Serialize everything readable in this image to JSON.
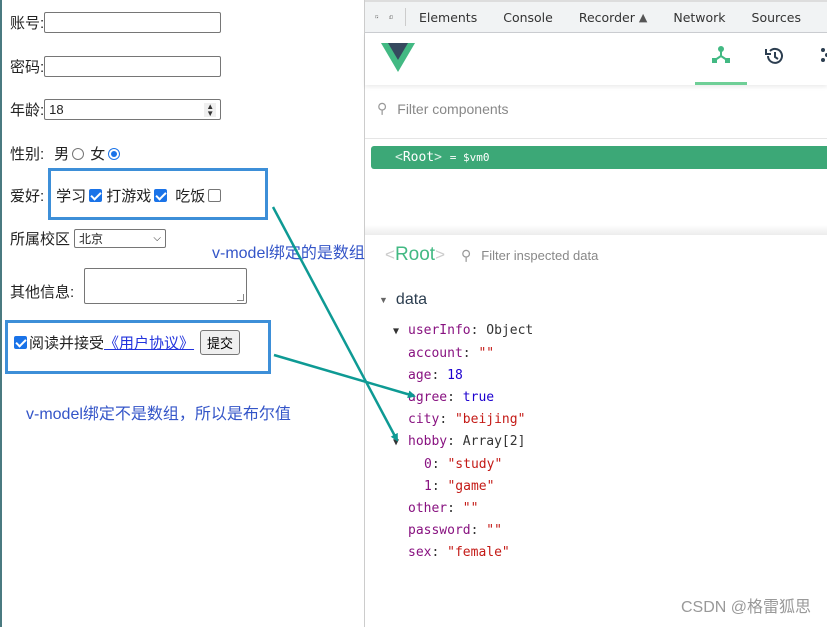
{
  "form": {
    "account_label": "账号:",
    "account_value": "",
    "password_label": "密码:",
    "password_value": "",
    "age_label": "年龄:",
    "age_value": "18",
    "sex_label": "性别:",
    "sex_options": [
      {
        "label": "男",
        "checked": false
      },
      {
        "label": "女",
        "checked": true
      }
    ],
    "hobby_label": "爱好:",
    "hobby_options": [
      {
        "label": "学习",
        "checked": true
      },
      {
        "label": "打游戏",
        "checked": true
      },
      {
        "label": "吃饭",
        "checked": false
      }
    ],
    "city_label": "所属校区",
    "city_selected": "北京",
    "other_label": "其他信息:",
    "other_value": "",
    "agree_checked": true,
    "agree_text": "阅读并接受",
    "agree_link": "《用户协议》",
    "submit_label": "提交"
  },
  "annotations": {
    "array_note": "v-model绑定的是数组",
    "bool_note": "v-model绑定不是数组，所以是布尔值",
    "color": "#3455c8",
    "arrow_color": "#0e9a94",
    "box_color": "#3d8fd8"
  },
  "devtools": {
    "tabs": [
      "Elements",
      "Console",
      "Recorder",
      "Network",
      "Sources"
    ],
    "vue_tabs": [
      "components-tree-icon",
      "timeline-history-icon",
      "more-dots-icon"
    ],
    "filter_components_placeholder": "Filter components",
    "root_tag": "Root",
    "root_vm": "$vm0",
    "inspector_title": "Root",
    "filter_data_placeholder": "Filter inspected data",
    "section_label": "data",
    "accent_color": "#42b983",
    "state": {
      "object_key": "userInfo",
      "object_type": "Object",
      "fields": [
        {
          "key": "account",
          "value": "\"\"",
          "type": "string"
        },
        {
          "key": "age",
          "value": "18",
          "type": "number"
        },
        {
          "key": "agree",
          "value": "true",
          "type": "boolean"
        },
        {
          "key": "city",
          "value": "\"beijing\"",
          "type": "string"
        }
      ],
      "hobby_key": "hobby",
      "hobby_type": "Array[2]",
      "hobby_items": [
        {
          "key": "0",
          "value": "\"study\""
        },
        {
          "key": "1",
          "value": "\"game\""
        }
      ],
      "fields_after": [
        {
          "key": "other",
          "value": "\"\"",
          "type": "string"
        },
        {
          "key": "password",
          "value": "\"\"",
          "type": "string"
        },
        {
          "key": "sex",
          "value": "\"female\"",
          "type": "string"
        }
      ]
    }
  },
  "watermark": "CSDN @格雷狐思"
}
